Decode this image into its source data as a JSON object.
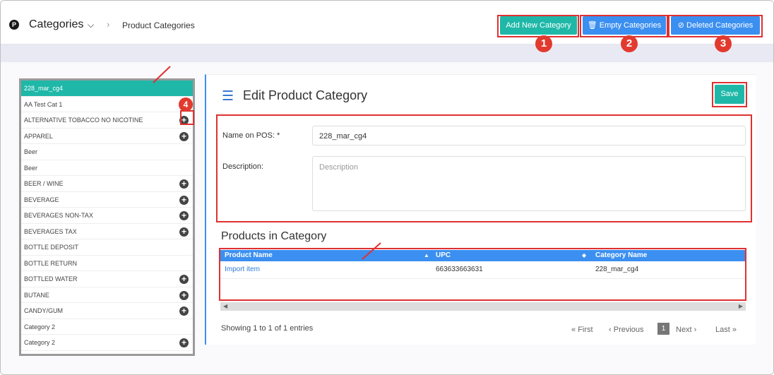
{
  "header": {
    "logo": "P",
    "title": "Categories",
    "breadcrumb": "Product Categories",
    "add_new": "Add New Category",
    "empty": "Empty Categories",
    "deleted": "Deleted Categories"
  },
  "callouts": [
    "1",
    "2",
    "3",
    "4"
  ],
  "categories": [
    {
      "label": "228_mar_cg4",
      "plus": false
    },
    {
      "label": "AA Test Cat 1",
      "plus": false
    },
    {
      "label": "ALTERNATIVE TOBACCO NO NICOTINE",
      "plus": true
    },
    {
      "label": "APPAREL",
      "plus": true
    },
    {
      "label": "Beer",
      "plus": false
    },
    {
      "label": "Beer",
      "plus": false
    },
    {
      "label": "BEER / WINE",
      "plus": true
    },
    {
      "label": "BEVERAGE",
      "plus": true
    },
    {
      "label": "BEVERAGES NON-TAX",
      "plus": true
    },
    {
      "label": "BEVERAGES TAX",
      "plus": true
    },
    {
      "label": "BOTTLE DEPOSIT",
      "plus": false
    },
    {
      "label": "BOTTLE RETURN",
      "plus": false
    },
    {
      "label": "BOTTLED WATER",
      "plus": true
    },
    {
      "label": "BUTANE",
      "plus": true
    },
    {
      "label": "CANDY/GUM",
      "plus": true
    },
    {
      "label": "Category 2",
      "plus": false
    },
    {
      "label": "Category 2",
      "plus": true
    }
  ],
  "edit": {
    "title": "Edit Product Category",
    "save": "Save",
    "name_label": "Name on POS: *",
    "name_value": "228_mar_cg4",
    "desc_label": "Description:",
    "desc_placeholder": "Description"
  },
  "products": {
    "title": "Products in Category",
    "columns": [
      "Product Name",
      "UPC",
      "Category Name"
    ],
    "rows": [
      [
        "Import item",
        "663633663631",
        "228_mar_cg4"
      ]
    ],
    "info": "Showing 1 to 1 of 1 entries"
  },
  "pagination": {
    "first": "First",
    "previous": "Previous",
    "current": "1",
    "next": "Next",
    "last": "Last"
  },
  "colors": {
    "accent": "#1fb8a8",
    "blue": "#3b8ff0",
    "callout": "#e23a2e"
  }
}
